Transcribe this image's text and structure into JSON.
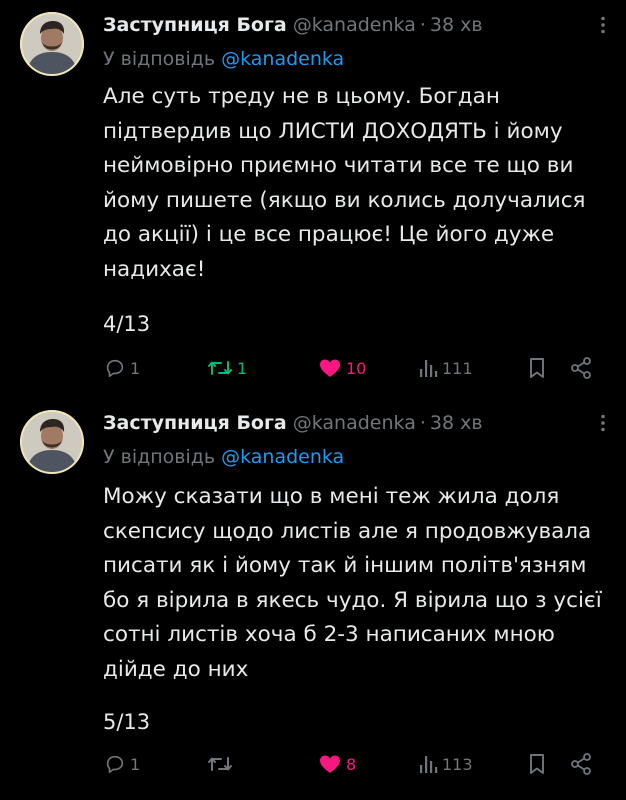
{
  "colors": {
    "background": "#000000",
    "text": "#e7e9ea",
    "muted": "#71767b",
    "link": "#1d9bf0",
    "retweet_active": "#00ba7c",
    "like_active": "#f91880"
  },
  "tweets": [
    {
      "display_name": "Заступниця Бога",
      "handle": "@kanadenka",
      "separator": "·",
      "time": "38 хв",
      "replying_label": "У відповідь",
      "replying_to": "@kanadenka",
      "text": "Але суть треду не в цьому. Богдан підтвердив що ЛИСТИ ДОХОДЯТЬ і йому неймовірно приємно читати все те що ви йому пишете (якщо ви колись долучалися до акції) і це все працює! Це його дуже надихає!",
      "counter": "4/13",
      "replies": "1",
      "retweets": "1",
      "retweeted": true,
      "likes": "10",
      "liked": true,
      "views": "111",
      "icons": [
        "more-icon",
        "reply-icon",
        "retweet-icon",
        "heart-icon",
        "views-icon",
        "bookmark-icon",
        "share-icon"
      ]
    },
    {
      "display_name": "Заступниця Бога",
      "handle": "@kanadenka",
      "separator": "·",
      "time": "38 хв",
      "replying_label": "У відповідь",
      "replying_to": "@kanadenka",
      "text": "Можу сказати що в мені теж жила доля скепсису щодо листів але я продовжувала писати як і йому так й іншим політв'язням бо я вірила в якесь чудо. Я вірила що з усієї сотні листів хоча б 2-3 написаних мною дійде до них",
      "counter": "5/13",
      "replies": "1",
      "retweets": "",
      "retweeted": false,
      "likes": "8",
      "liked": true,
      "views": "113",
      "icons": [
        "more-icon",
        "reply-icon",
        "retweet-icon",
        "heart-icon",
        "views-icon",
        "bookmark-icon",
        "share-icon"
      ]
    }
  ]
}
